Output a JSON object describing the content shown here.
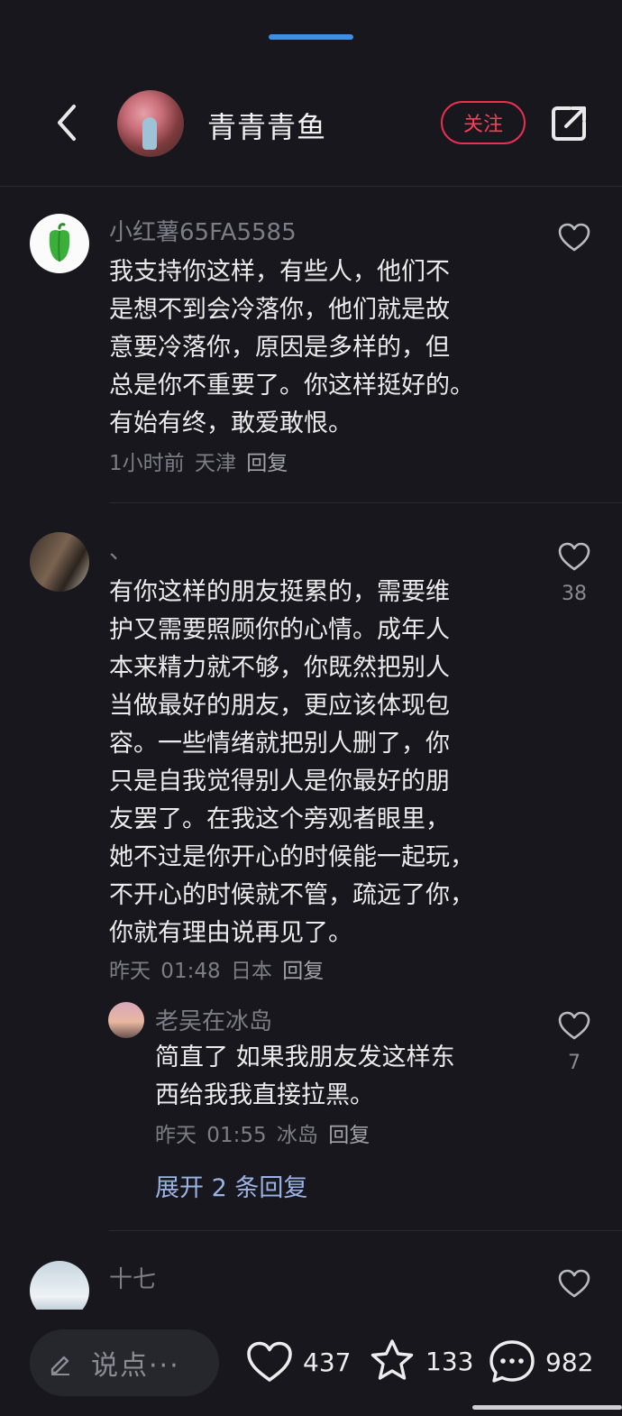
{
  "header": {
    "user_name": "青青青鱼",
    "follow_label": "关注"
  },
  "comments": [
    {
      "username": "小红薯65FA5585",
      "lines": [
        "我支持你这样，有些人，他们不",
        "是想不到会冷落你，他们就是故",
        "意要冷落你，原因是多样的，但",
        "总是你不重要了。你这样挺好的。",
        "有始有终，敢爱敢恨。"
      ],
      "time": "1小时前",
      "location": "天津",
      "reply_label": "回复",
      "likes": ""
    },
    {
      "username": "、",
      "lines": [
        "有你这样的朋友挺累的，需要维",
        "护又需要照顾你的心情。成年人",
        "本来精力就不够，你既然把别人",
        "当做最好的朋友，更应该体现包",
        "容。一些情绪就把别人删了，你",
        "只是自我觉得别人是你最好的朋",
        "友罢了。在我这个旁观者眼里，",
        "她不过是你开心的时候能一起玩，",
        "不开心的时候就不管，疏远了你，",
        "你就有理由说再见了。"
      ],
      "time": "昨天 01:48",
      "location": "日本",
      "reply_label": "回复",
      "likes": "38"
    },
    {
      "username": "十七",
      "lines": [],
      "likes": ""
    }
  ],
  "sub_reply": {
    "username": "老吴在冰岛",
    "lines": [
      "简直了 如果我朋友发这样东",
      "西给我我直接拉黑。"
    ],
    "time": "昨天 01:55",
    "location": "冰岛",
    "reply_label": "回复",
    "likes": "7"
  },
  "expand_replies": "展开 2 条回复",
  "bottom_bar": {
    "input_placeholder": "说点···",
    "likes": "437",
    "favorites": "133",
    "comments": "982"
  },
  "colors": {
    "background": "#17171d",
    "accent": "#ff3b5c",
    "progress": "#3b8fe6",
    "link": "#9ab3e4"
  },
  "icons": [
    "back-icon",
    "share-icon",
    "heart-icon",
    "star-icon",
    "comment-icon",
    "pen-icon",
    "pepper-icon"
  ]
}
